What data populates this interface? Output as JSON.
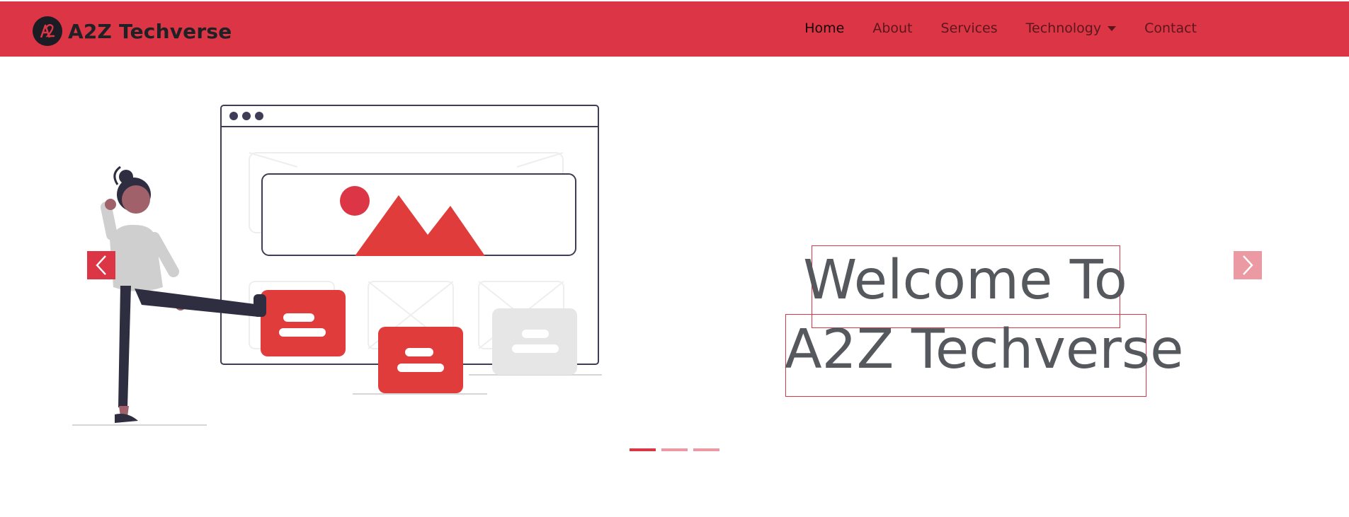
{
  "brand": {
    "name": "A2Z Techverse",
    "logo_icon": "a2z-logo-icon"
  },
  "nav": {
    "items": [
      {
        "label": "Home",
        "active": true
      },
      {
        "label": "About",
        "active": false
      },
      {
        "label": "Services",
        "active": false
      },
      {
        "label": "Technology",
        "active": false,
        "dropdown": true
      },
      {
        "label": "Contact",
        "active": false
      }
    ]
  },
  "hero": {
    "headline_line1": "Welcome To",
    "headline_line2": "A2Z Techverse",
    "prev_icon": "chevron-left-icon",
    "next_icon": "chevron-right-icon",
    "slides": {
      "count": 3,
      "active_index": 0
    }
  },
  "colors": {
    "primary": "#dc3545",
    "primary_light": "#eb9aa4",
    "headline_text": "#55585c",
    "dark": "#2f2e41"
  }
}
